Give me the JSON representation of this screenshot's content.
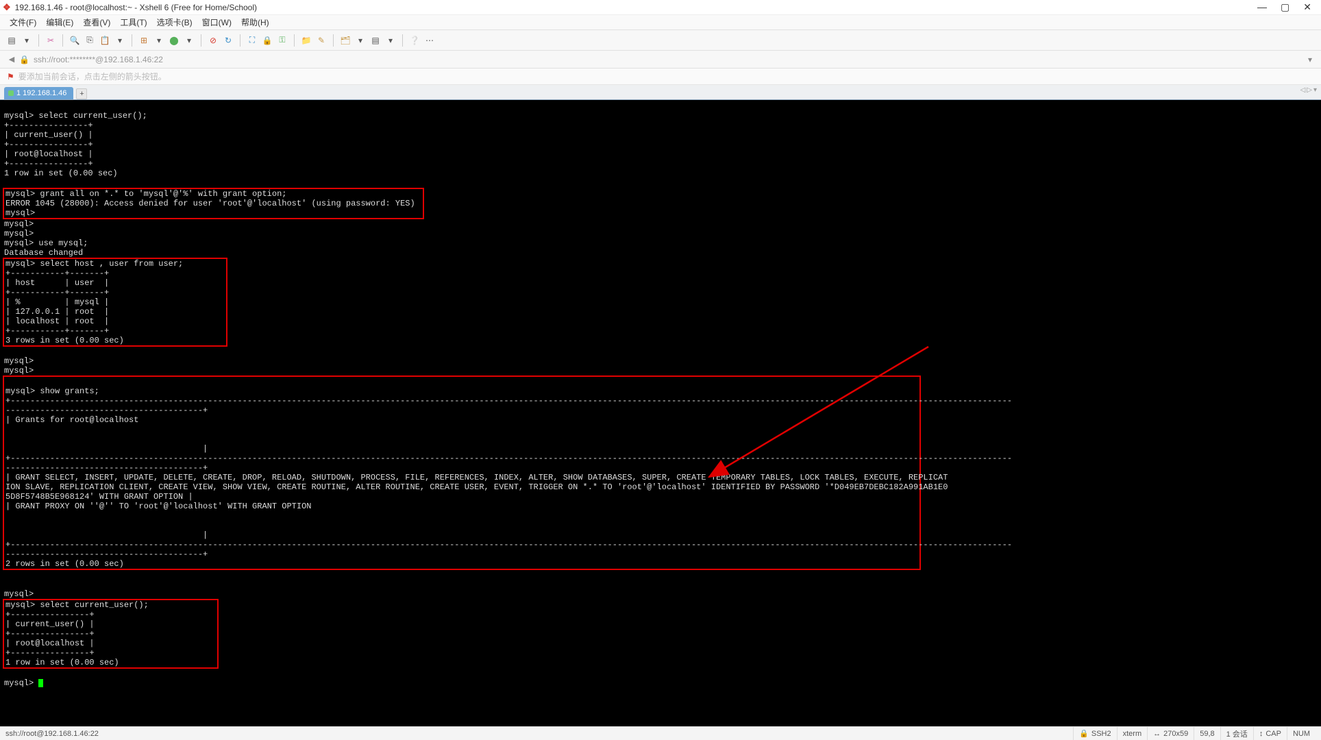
{
  "window": {
    "title": "192.168.1.46 - root@localhost:~ - Xshell 6 (Free for Home/School)"
  },
  "menu": {
    "file": "文件(F)",
    "edit": "编辑(E)",
    "view": "查看(V)",
    "tools": "工具(T)",
    "tabs": "选项卡(B)",
    "window": "窗口(W)",
    "help": "帮助(H)"
  },
  "address": {
    "text": "ssh://root:********@192.168.1.46:22"
  },
  "hint": {
    "text": "要添加当前会话，点击左侧的箭头按钮。"
  },
  "tab": {
    "label": "1 192.168.1.46",
    "plus": "+"
  },
  "terminal": {
    "block1": "mysql> select current_user();\n+----------------+\n| current_user() |\n+----------------+\n| root@localhost |\n+----------------+\n1 row in set (0.00 sec)\n",
    "box1": "mysql> grant all on *.* to 'mysql'@'%' with grant option;\nERROR 1045 (28000): Access denied for user 'root'@'localhost' (using password: YES)\nmysql>",
    "block2": "mysql>\nmysql>\nmysql> use mysql;\nDatabase changed",
    "box2": "mysql> select host , user from user;\n+-----------+-------+\n| host      | user  |\n+-----------+-------+\n| %         | mysql |\n| 127.0.0.1 | root  |\n| localhost | root  |\n+-----------+-------+\n3 rows in set (0.00 sec)",
    "block3": "\nmysql>\nmysql>",
    "box3_line1": "mysql> show grants;",
    "box3_dash_full": "+-----------------------------------------------------------------------------------------------------------------------------------------------------------------------------------------------------------",
    "box3_dash_short": "----------------------------------------+",
    "box3_grants_header": "| Grants for root@localhost",
    "box3_pipe_align": "                                        |",
    "box3_grant1a": "| GRANT SELECT, INSERT, UPDATE, DELETE, CREATE, DROP, RELOAD, SHUTDOWN, PROCESS, FILE, REFERENCES, INDEX, ALTER, SHOW DATABASES, SUPER, CREATE TEMPORARY TABLES, LOCK TABLES, EXECUTE, REPLICAT",
    "box3_grant1b": "ION SLAVE, REPLICATION CLIENT, CREATE VIEW, SHOW VIEW, CREATE ROUTINE, ALTER ROUTINE, CREATE USER, EVENT, TRIGGER ON *.* TO 'root'@'localhost' IDENTIFIED BY PASSWORD '*D049EB7DEBC182A991AB1E0",
    "box3_grant1c": "5D8F5748B5E968124' WITH GRANT OPTION |",
    "box3_grant2": "| GRANT PROXY ON ''@'' TO 'root'@'localhost' WITH GRANT OPTION",
    "box3_rows": "2 rows in set (0.00 sec)",
    "block4": "\nmysql>",
    "box4": "mysql> select current_user();\n+----------------+\n| current_user() |\n+----------------+\n| root@localhost |\n+----------------+\n1 row in set (0.00 sec)",
    "prompt": "\nmysql> "
  },
  "status": {
    "left": "ssh://root@192.168.1.46:22",
    "ssh": "SSH2",
    "term": "xterm",
    "size": "270x59",
    "pos": "59,8",
    "sess": "1 会话",
    "cap": "CAP",
    "num": "NUM"
  },
  "watermark": ""
}
